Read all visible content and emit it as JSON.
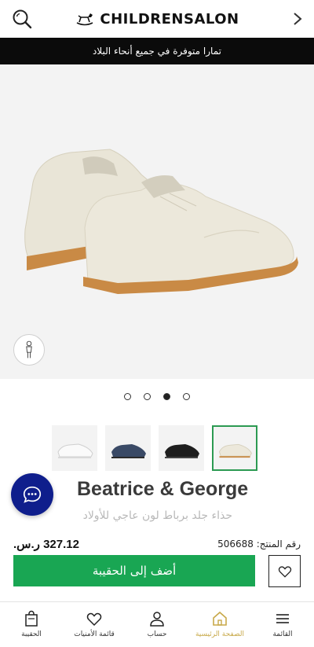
{
  "header": {
    "brand": "CHILDRENSALON",
    "search_icon": "search-icon",
    "next_icon": "chevron-right-icon"
  },
  "banner": {
    "text": "تمارا متوفرة في جميع أنحاء البلاد"
  },
  "gallery": {
    "image_count": 4,
    "active_index": 2,
    "thumbnail_colors": [
      "white",
      "navy",
      "black",
      "ivory"
    ],
    "selected_thumbnail": 3
  },
  "product": {
    "brand": "Beatrice & George",
    "name": "حذاء جلد برباط لون عاجي للأولاد",
    "price": "327.12 ر.س.",
    "sku_label": "رقم المنتج: 506688"
  },
  "actions": {
    "add_to_bag": "أضف إلى الحقيبة"
  },
  "tabbar": {
    "items": [
      {
        "label": "الحقيبة",
        "icon": "bag-icon"
      },
      {
        "label": "قائمة الأمنيات",
        "icon": "heart-icon"
      },
      {
        "label": "حساب",
        "icon": "user-icon"
      },
      {
        "label": "الصفحة الرئيسية",
        "icon": "home-icon"
      },
      {
        "label": "القائمة",
        "icon": "menu-icon"
      }
    ],
    "active_index": 3
  },
  "colors": {
    "banner_bg": "#0b0b0b",
    "add_button": "#19a653",
    "chat_button": "#0f1e8c",
    "active_tab": "#c8a94a",
    "selected_thumb_border": "#2c9a52"
  }
}
